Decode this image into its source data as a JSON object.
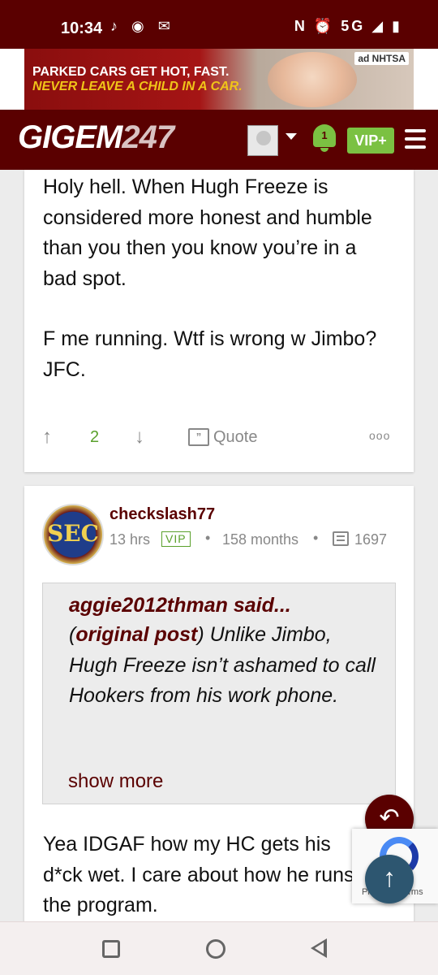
{
  "status_bar": {
    "time": "10:34",
    "left_icons": "♪ ◉ ✉",
    "right_icons": "N ⏰ 5G ◢ ▮"
  },
  "ad": {
    "line1": "PARKED CARS GET HOT, FAST.",
    "line2": "NEVER LEAVE A CHILD IN A CAR.",
    "badge": "ad NHTSA"
  },
  "header": {
    "logo_text": "GIGEM",
    "logo_number": "247",
    "notification_count": "1",
    "vip_label": "VIP+"
  },
  "post1": {
    "paragraph1": "Holy hell. When Hugh Freeze is considered more honest and humble than you then you know you’re in a bad spot.",
    "paragraph2": "F me running. Wtf is wrong w Jimbo? JFC.",
    "upvotes": "2",
    "quote_label": "Quote",
    "more_label": "ooo"
  },
  "post2": {
    "avatar_text": "SEC",
    "username": "checkslash77",
    "time_ago": "13 hrs",
    "vip_badge": "VIP",
    "tenure": "158 months",
    "post_count": "1697",
    "quote": {
      "author": "aggie2012thman said...",
      "original_post": "original post",
      "text": " Unlike Jimbo, Hugh Freeze isn’t ashamed to call Hookers from his work phone.",
      "show_more": "show more"
    },
    "body": "Yea IDGAF how my HC gets his d*ck wet. I care about how he runs the program."
  },
  "recaptcha": {
    "text": "Privacy - Terms"
  }
}
